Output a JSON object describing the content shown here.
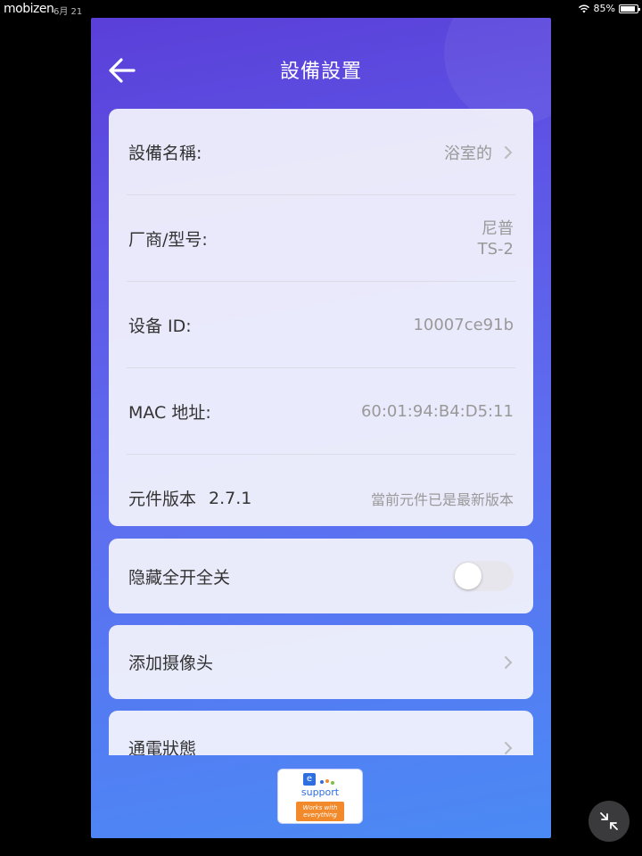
{
  "status_bar": {
    "left_text": "mobizen",
    "time_text": "6月 21",
    "battery": "85%"
  },
  "header": {
    "title": "設備設置",
    "back_icon": "arrow-left-icon"
  },
  "device_info": {
    "name": {
      "label": "設備名稱:",
      "value": "浴室的"
    },
    "model": {
      "label": "厂商/型号:",
      "value_line1": "尼普",
      "value_line2": "TS-2"
    },
    "device_id": {
      "label": "设备 ID:",
      "value": "10007ce91b"
    },
    "mac": {
      "label": "MAC 地址:",
      "value": "60:01:94:B4:D5:11"
    },
    "firmware": {
      "label": "元件版本",
      "version": "2.7.1",
      "status": "當前元件已是最新版本"
    }
  },
  "hide_all_toggle": {
    "label": "隐藏全开全关",
    "on": false
  },
  "add_camera": {
    "label": "添加摄像头"
  },
  "power_state": {
    "label": "通電狀態"
  },
  "badge": {
    "e": "e",
    "word": "support",
    "line1": "Works with",
    "line2": "everything"
  },
  "colors": {
    "gradient_top": "#5a3fd8",
    "gradient_bottom": "#4b8af5",
    "card_bg": "#f4f4fc",
    "label": "#333333",
    "value": "#999999",
    "badge_orange": "#f28a2b"
  }
}
